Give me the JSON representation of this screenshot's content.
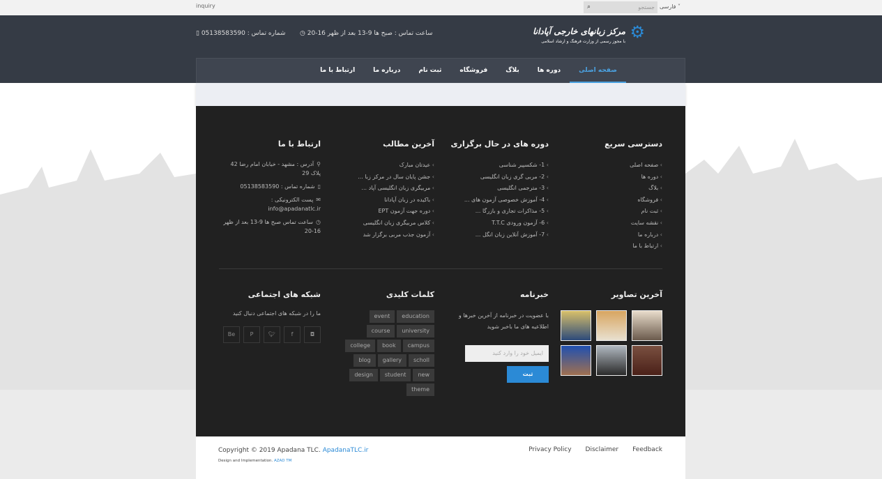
{
  "topbar": {
    "inquiry": "inquiry",
    "search_placeholder": "جستجو",
    "language": "فارسی"
  },
  "header": {
    "logo_title": "مرکز زبانهای خارجی آپادانا",
    "logo_subtitle": "با مجوز رسمی از وزارت فرهنگ و ارشاد اسلامی",
    "hours": "ساعت تماس : صبح ها 9-13 بعد از ظهر 16-20",
    "phone": "شماره تماس : 05138583590"
  },
  "nav": [
    {
      "label": "صفحه اصلی",
      "active": true
    },
    {
      "label": "دوره ها"
    },
    {
      "label": "بلاگ"
    },
    {
      "label": "فروشگاه"
    },
    {
      "label": "ثبت نام"
    },
    {
      "label": "درباره ما"
    },
    {
      "label": "ارتباط با ما"
    }
  ],
  "footer": {
    "quick": {
      "title": "دسترسی سریع",
      "items": [
        "صفحه اصلی",
        "دوره ها",
        "بلاگ",
        "فروشگاه",
        "ثبت نام",
        "نقشه سایت",
        "درباره ما",
        "ارتباط با ما"
      ]
    },
    "courses": {
      "title": "دوره های در حال برگزاری",
      "items": [
        "1- شکسپیر شناسی",
        "2- مربی گری زبان انگلیسی",
        "3- مترجمی انگلیسی",
        "4- آموزش خصوصی آزمون های ...",
        "5- مذاکرات تجاری و بازرگا ...",
        "6- آزمون ورودی T.T.C",
        "7- آموزش آنلاین زبان انگل ..."
      ]
    },
    "posts": {
      "title": "آخرین مطالب",
      "items": [
        "عیدتان مبارک",
        "جشن پایان سال در مرکز زبا ...",
        "مربیگری زبان انگلیسی آپاد ...",
        "باکیده در زبان آپادانا",
        "دوره جهت آزمون EPT",
        "کلاس مربیگری زبان انگلیسی",
        "آزمون جذب مربی برگزار شد"
      ]
    },
    "contact": {
      "title": "ارتباط با ما",
      "address": "آدرس : مشهد - خیابان امام رضا 42 پلاک 29",
      "phone": "شماره تماس : 05138583590",
      "email_label": "پست الکترونیکی :",
      "email": "info@apadanatlc.ir",
      "hours": "ساعت تماس صبح ها 9-13 بعد از ظهر 16-20"
    },
    "gallery": {
      "title": "آخرین تصاویر"
    },
    "newsletter": {
      "title": "خبرنامه",
      "text": "با عضویت در خبرنامه از آخرین خبرها و اطلاعیه های ما باخبر شوید",
      "email_placeholder": "ایمیل خود را وارد کنید",
      "submit": "ثبت"
    },
    "tags": {
      "title": "کلمات کلیدی",
      "rows": [
        [
          "education",
          "event"
        ],
        [
          "university",
          "course"
        ],
        [
          "campus",
          "book",
          "college"
        ],
        [
          "scholl",
          "gallery",
          "blog"
        ],
        [
          "new",
          "student",
          "design"
        ],
        [
          "theme"
        ]
      ]
    },
    "social": {
      "title": "شبکه های اجتماعی",
      "text": "ما را در شبکه های اجتماعی دنبال کنید",
      "icons": [
        "instagram",
        "facebook",
        "twitter",
        "pinterest",
        "behance"
      ]
    }
  },
  "bottom": {
    "copyright": "Copyright © 2019 Apadana TLC.",
    "site_link": "ApadanaTLC.ir",
    "impl": "Design and Implementation.",
    "impl_link": "AZAD TM",
    "links": [
      "Privacy Policy",
      "Disclaimer",
      "Feedback"
    ]
  },
  "colors": {
    "accent": "#2b8ad6",
    "header": "#353b45",
    "footer": "#212121"
  }
}
